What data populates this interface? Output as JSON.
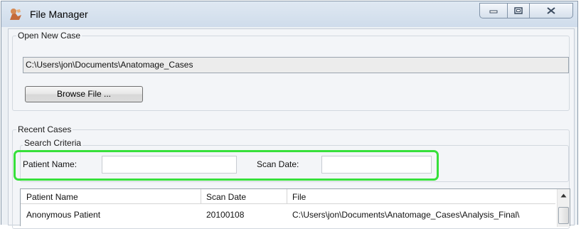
{
  "window": {
    "title": "File Manager",
    "icon": "anatomy-icon"
  },
  "open_case": {
    "group_label": "Open New Case",
    "path_value": "C:\\Users\\jon\\Documents\\Anatomage_Cases",
    "browse_label": "Browse File ..."
  },
  "recent_cases": {
    "group_label": "Recent Cases",
    "search_criteria_label": "Search Criteria",
    "patient_name_label": "Patient Name:",
    "patient_name_value": "",
    "scan_date_label": "Scan Date:",
    "scan_date_value": "",
    "highlight_color": "#37e03b"
  },
  "table": {
    "columns": [
      "Patient Name",
      "Scan Date",
      "File"
    ],
    "rows": [
      {
        "patient_name": "Anonymous Patient",
        "scan_date": "20100108",
        "file": "C:\\Users\\jon\\Documents\\Anatomage_Cases\\Analysis_Final\\"
      }
    ]
  }
}
